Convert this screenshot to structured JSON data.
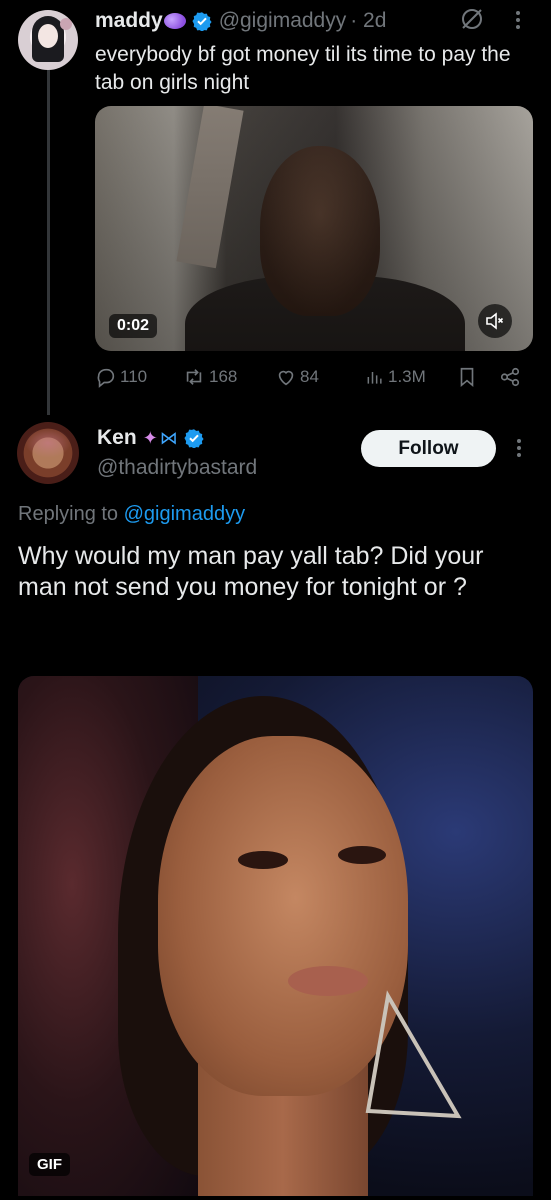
{
  "tweet1": {
    "name": "maddy",
    "handle": "@gigimaddyy",
    "time": "· 2d",
    "text": "everybody bf got money til its time to pay the tab on girls night",
    "video_time": "0:02",
    "replies": "110",
    "reposts": "168",
    "likes": "84",
    "views": "1.3M"
  },
  "tweet2": {
    "name": "Ken",
    "handle": "@thadirtybastard",
    "follow_label": "Follow",
    "replying_prefix": "Replying to",
    "replying_to": "@gigimaddyy",
    "text": "Why would my man pay yall tab? Did your man not send you money for tonight or ?",
    "media_badge": "GIF"
  },
  "colors": {
    "background": "#000000",
    "text": "#e7e9ea",
    "muted": "#71767b",
    "accent": "#1d9bf0",
    "follow_bg": "#eff3f4"
  },
  "icons": {
    "verified": "verified-badge-icon",
    "grok": "grok-icon",
    "more": "more-vertical-icon",
    "reply": "reply-icon",
    "repost": "repost-icon",
    "like": "heart-icon",
    "views": "views-icon",
    "bookmark": "bookmark-icon",
    "share": "share-icon",
    "mute": "mute-icon"
  }
}
